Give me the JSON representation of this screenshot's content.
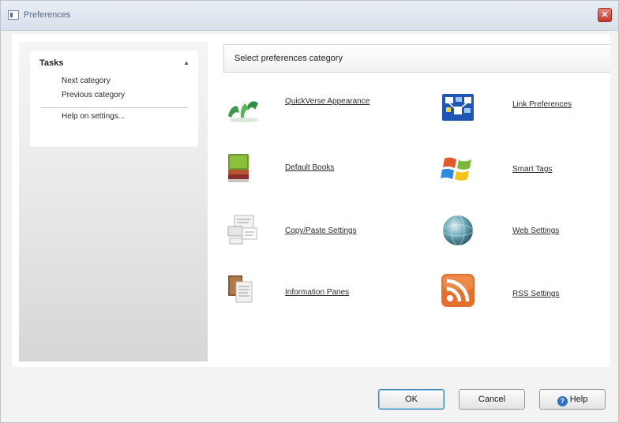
{
  "window": {
    "title": "Preferences",
    "close_icon": "close-icon"
  },
  "tasks": {
    "title": "Tasks",
    "collapse_icon": "collapse-chevron-icon",
    "items": [
      {
        "label": "Next category"
      },
      {
        "label": "Previous category"
      },
      {
        "label": "Help on settings..."
      }
    ]
  },
  "main": {
    "header": "Select preferences category",
    "categories": [
      {
        "label": "QuickVerse Appearance",
        "icon": "appearance-icon"
      },
      {
        "label": "Link Preferences",
        "icon": "link-preferences-icon"
      },
      {
        "label": "Default Books",
        "icon": "books-icon"
      },
      {
        "label": "Smart Tags",
        "icon": "windows-flag-icon"
      },
      {
        "label": "Copy/Paste Settings",
        "icon": "copy-paste-icon"
      },
      {
        "label": "Web Settings",
        "icon": "globe-icon"
      },
      {
        "label": "Information Panes",
        "icon": "information-panes-icon"
      },
      {
        "label": "RSS Settings",
        "icon": "rss-icon"
      }
    ]
  },
  "buttons": {
    "ok": "OK",
    "cancel": "Cancel",
    "help": "Help"
  },
  "colors": {
    "accent_blue": "#3c7fb1",
    "rss_orange": "#e4702d",
    "close_red": "#c0392b"
  }
}
